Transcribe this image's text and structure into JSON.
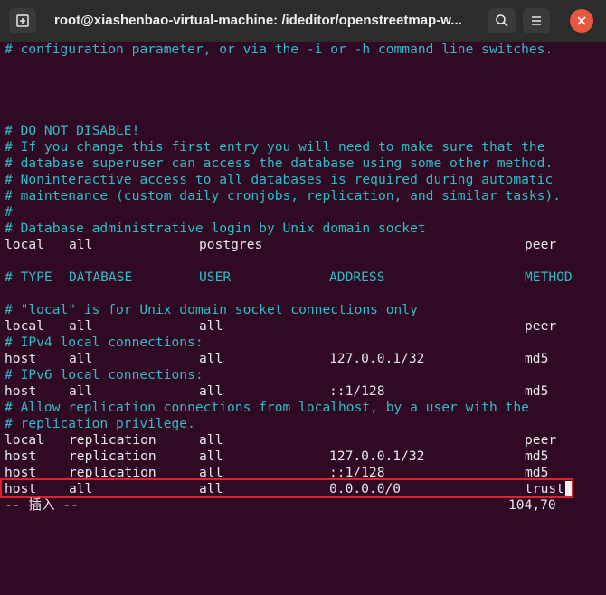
{
  "window": {
    "title": "root@xiashenbao-virtual-machine: /ideditor/openstreetmap-w...",
    "new_tab_icon": "new-tab-icon",
    "search_icon": "search-icon",
    "menu_icon": "hamburger-menu-icon"
  },
  "lines": {
    "l0": "# configuration parameter, or via the -i or -h command line switches.",
    "l1": "# DO NOT DISABLE!",
    "l2": "# If you change this first entry you will need to make sure that the",
    "l3": "# database superuser can access the database using some other method.",
    "l4": "# Noninteractive access to all databases is required during automatic",
    "l5": "# maintenance (custom daily cronjobs, replication, and similar tasks).",
    "l6": "#",
    "l7": "# Database administrative login by Unix domain socket",
    "l9": "# \"local\" is for Unix domain socket connections only",
    "l11": "# IPv4 local connections:",
    "l13": "# IPv6 local connections:",
    "l15": "# Allow replication connections from localhost, by a user with the",
    "l16": "# replication privilege."
  },
  "header_row": {
    "type": "# TYPE",
    "database": "DATABASE",
    "user": "USER",
    "address": "ADDRESS",
    "method": "METHOD"
  },
  "rows": [
    {
      "type": "local",
      "database": "all",
      "user": "postgres",
      "address": "",
      "method": "peer"
    },
    {
      "type": "local",
      "database": "all",
      "user": "all",
      "address": "",
      "method": "peer"
    },
    {
      "type": "host",
      "database": "all",
      "user": "all",
      "address": "127.0.0.1/32",
      "method": "md5"
    },
    {
      "type": "host",
      "database": "all",
      "user": "all",
      "address": "::1/128",
      "method": "md5"
    },
    {
      "type": "local",
      "database": "replication",
      "user": "all",
      "address": "",
      "method": "peer"
    },
    {
      "type": "host",
      "database": "replication",
      "user": "all",
      "address": "127.0.0.1/32",
      "method": "md5"
    },
    {
      "type": "host",
      "database": "replication",
      "user": "all",
      "address": "::1/128",
      "method": "md5"
    },
    {
      "type": "host",
      "database": "all",
      "user": "all",
      "address": "0.0.0.0/0",
      "method": "trust"
    }
  ],
  "status": {
    "mode": "-- 插入 --",
    "position": "104,70"
  },
  "colors": {
    "background": "#300a24",
    "comment": "#2ebcc6",
    "text": "#e8e8e8",
    "highlight_box": "#e0202a"
  }
}
